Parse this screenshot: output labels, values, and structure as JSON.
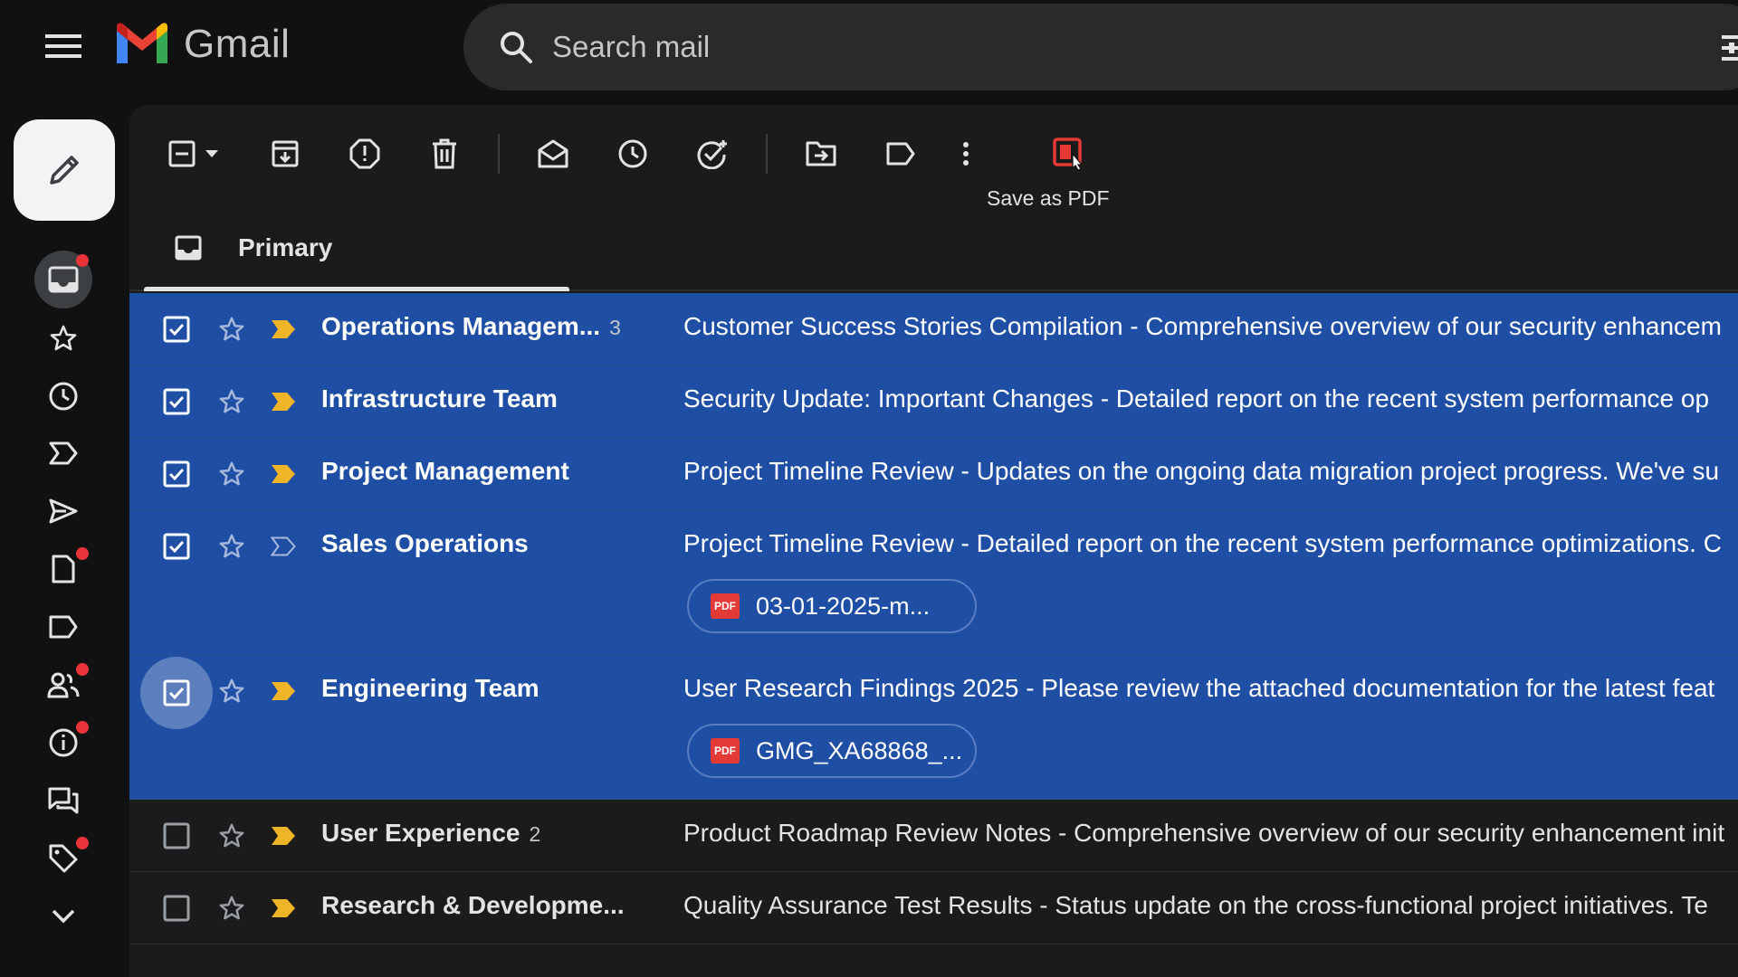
{
  "header": {
    "app_name": "Gmail",
    "search_placeholder": "Search mail"
  },
  "toolbar": {
    "tooltip": "Save as PDF"
  },
  "tabs": [
    {
      "label": "Primary",
      "active": true
    }
  ],
  "colors": {
    "selected_row": "#1f4ea5",
    "important_marker": "#f0b429",
    "pdf_red": "#e53935",
    "unread_dot": "#e8333a"
  },
  "emails": [
    {
      "sender": "Operations Managem...",
      "count": "3",
      "subject": "Customer Success Stories Compilation - Comprehensive overview of our security enhancem",
      "selected": true,
      "important": true
    },
    {
      "sender": "Infrastructure Team",
      "count": "",
      "subject": "Security Update: Important Changes - Detailed report on the recent system performance op",
      "selected": true,
      "important": true
    },
    {
      "sender": "Project Management",
      "count": "",
      "subject": "Project Timeline Review - Updates on the ongoing data migration project progress. We've su",
      "selected": true,
      "important": true
    },
    {
      "sender": "Sales Operations",
      "count": "",
      "subject": "Project Timeline Review - Detailed report on the recent system performance optimizations. C",
      "selected": true,
      "important": false,
      "attachment": "03-01-2025-m..."
    },
    {
      "sender": "Engineering Team",
      "count": "",
      "subject": "User Research Findings 2025 - Please review the attached documentation for the latest feat",
      "selected": true,
      "important": true,
      "attachment": "GMG_XA68868_..."
    },
    {
      "sender": "User Experience",
      "count": "2",
      "subject": "Product Roadmap Review Notes - Comprehensive overview of our security enhancement init",
      "selected": false,
      "important": true
    },
    {
      "sender": "Research & Developme...",
      "count": "",
      "subject": "Quality Assurance Test Results - Status update on the cross-functional project initiatives. Te",
      "selected": false,
      "important": true
    }
  ],
  "attachment_badge": "PDF"
}
